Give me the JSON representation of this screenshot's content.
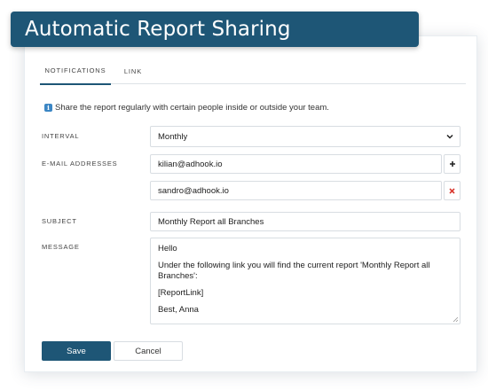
{
  "header": {
    "title": "Automatic Report Sharing"
  },
  "tabs": [
    {
      "label": "NOTIFICATIONS",
      "active": true
    },
    {
      "label": "LINK",
      "active": false
    }
  ],
  "info": {
    "icon": "info-icon",
    "text": "Share the report regularly with certain people inside or outside your team."
  },
  "interval": {
    "label": "INTERVAL",
    "value": "Monthly"
  },
  "emails": {
    "label": "E-MAIL ADDRESSES",
    "items": [
      "kilian@adhook.io",
      "sandro@adhook.io"
    ],
    "add_icon": "plus-icon",
    "remove_icon": "remove-x-icon"
  },
  "subject": {
    "label": "SUBJECT",
    "value": "Monthly Report all Branches"
  },
  "message": {
    "label": "MESSAGE",
    "lines": [
      "Hello",
      "Under the following link you will find the current report 'Monthly Report all Branches':",
      "[ReportLink]",
      "Best, Anna"
    ]
  },
  "buttons": {
    "save": "Save",
    "cancel": "Cancel"
  },
  "colors": {
    "primary": "#1e5676",
    "remove": "#d9382f",
    "info": "#3b86c4"
  }
}
